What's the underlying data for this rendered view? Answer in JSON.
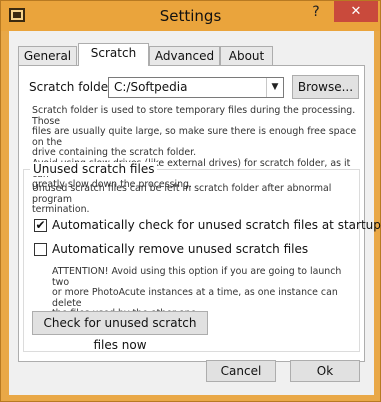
{
  "window": {
    "title": "Settings",
    "help_glyph": "?",
    "close_glyph": "✕"
  },
  "tabs": [
    {
      "label": "General"
    },
    {
      "label": "Scratch"
    },
    {
      "label": "Advanced"
    },
    {
      "label": "About"
    }
  ],
  "scratch": {
    "folder_label": "Scratch folder:",
    "folder_value": "C:/Softpedia",
    "browse_label": "Browse...",
    "desc_lines": [
      "Scratch folder is used to store temporary files during the processing. Those",
      "files are usually quite large, so make sure there is enough free space on the",
      "drive containing the scratch folder.",
      "Avoid using slow drives (like external drives) for scratch folder, as it can",
      "greatly slow down the processing."
    ]
  },
  "unused": {
    "group_title": "Unused scratch files",
    "desc_lines": [
      "Unused scratch files can be left in scratch folder after abnormal program",
      "termination."
    ],
    "auto_check_label": "Automatically check for unused scratch files at startup",
    "auto_check_checked": true,
    "auto_remove_label": "Automatically remove unused scratch files",
    "auto_remove_checked": false,
    "attention_lines": [
      "ATTENTION! Avoid using this option if you are going to launch two",
      "or more PhotoAcute instances at a time, as one instance can delete",
      "the files used by the other one."
    ],
    "check_now_label": "Check for unused scratch files now"
  },
  "footer": {
    "cancel_label": "Cancel",
    "ok_label": "Ok"
  },
  "colors": {
    "titlebar": "#eaa43c",
    "close_button": "#c94a3c",
    "panel": "#ffffff",
    "client": "#f0f0f0"
  }
}
